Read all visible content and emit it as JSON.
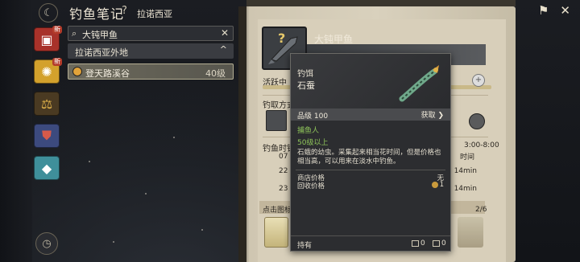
{
  "header": {
    "title": "钓鱼笔记",
    "help": "?",
    "region": "拉诺西亚"
  },
  "rail": {
    "items": [
      {
        "icon": "fish-book-icon",
        "badge": "新",
        "color": "#a8322a"
      },
      {
        "icon": "sun-medal-icon",
        "badge": "新",
        "color": "#d3a12c"
      },
      {
        "icon": "scales-icon",
        "badge": "",
        "color": "#4a3a22"
      },
      {
        "icon": "armor-icon",
        "badge": "",
        "color": "#3c4a7e"
      },
      {
        "icon": "crystal-icon",
        "badge": "",
        "color": "#3f8f9a"
      }
    ]
  },
  "search": {
    "value": "大钝甲鱼",
    "icon": "search-icon"
  },
  "group": {
    "label": "拉诺西亚外地",
    "chev": "^"
  },
  "spot": {
    "label": "登天路溪谷",
    "level": "40级"
  },
  "fish": {
    "name": "大钝甲鱼",
    "unknown": "?",
    "active_label": "活跃中",
    "method_label": "钓取方式",
    "time_label": "钓鱼时钟",
    "time_range": "3:00-8:00",
    "time_sub": "时间",
    "rows": [
      {
        "l": "07",
        "r": ""
      },
      {
        "l": "22",
        "r": "14min"
      },
      {
        "l": "23",
        "r": "14min"
      }
    ],
    "hint": "点击图标",
    "page": "2/6"
  },
  "tooltip": {
    "category": "钓饵",
    "name": "石蚕",
    "grade": "品级 100",
    "get": "获取 ❯",
    "role": "捕鱼人",
    "level": "50级以上",
    "desc": "石蛾的幼虫。采集起来相当花时间，但是价格也相当高，可以用来在淡水中钓鱼。",
    "shop_label": "商店价格",
    "shop_value": "无",
    "recycle_label": "回收价格",
    "recycle_value": "1",
    "own_label": "持有",
    "own_home": "0",
    "own_bag": "0"
  }
}
